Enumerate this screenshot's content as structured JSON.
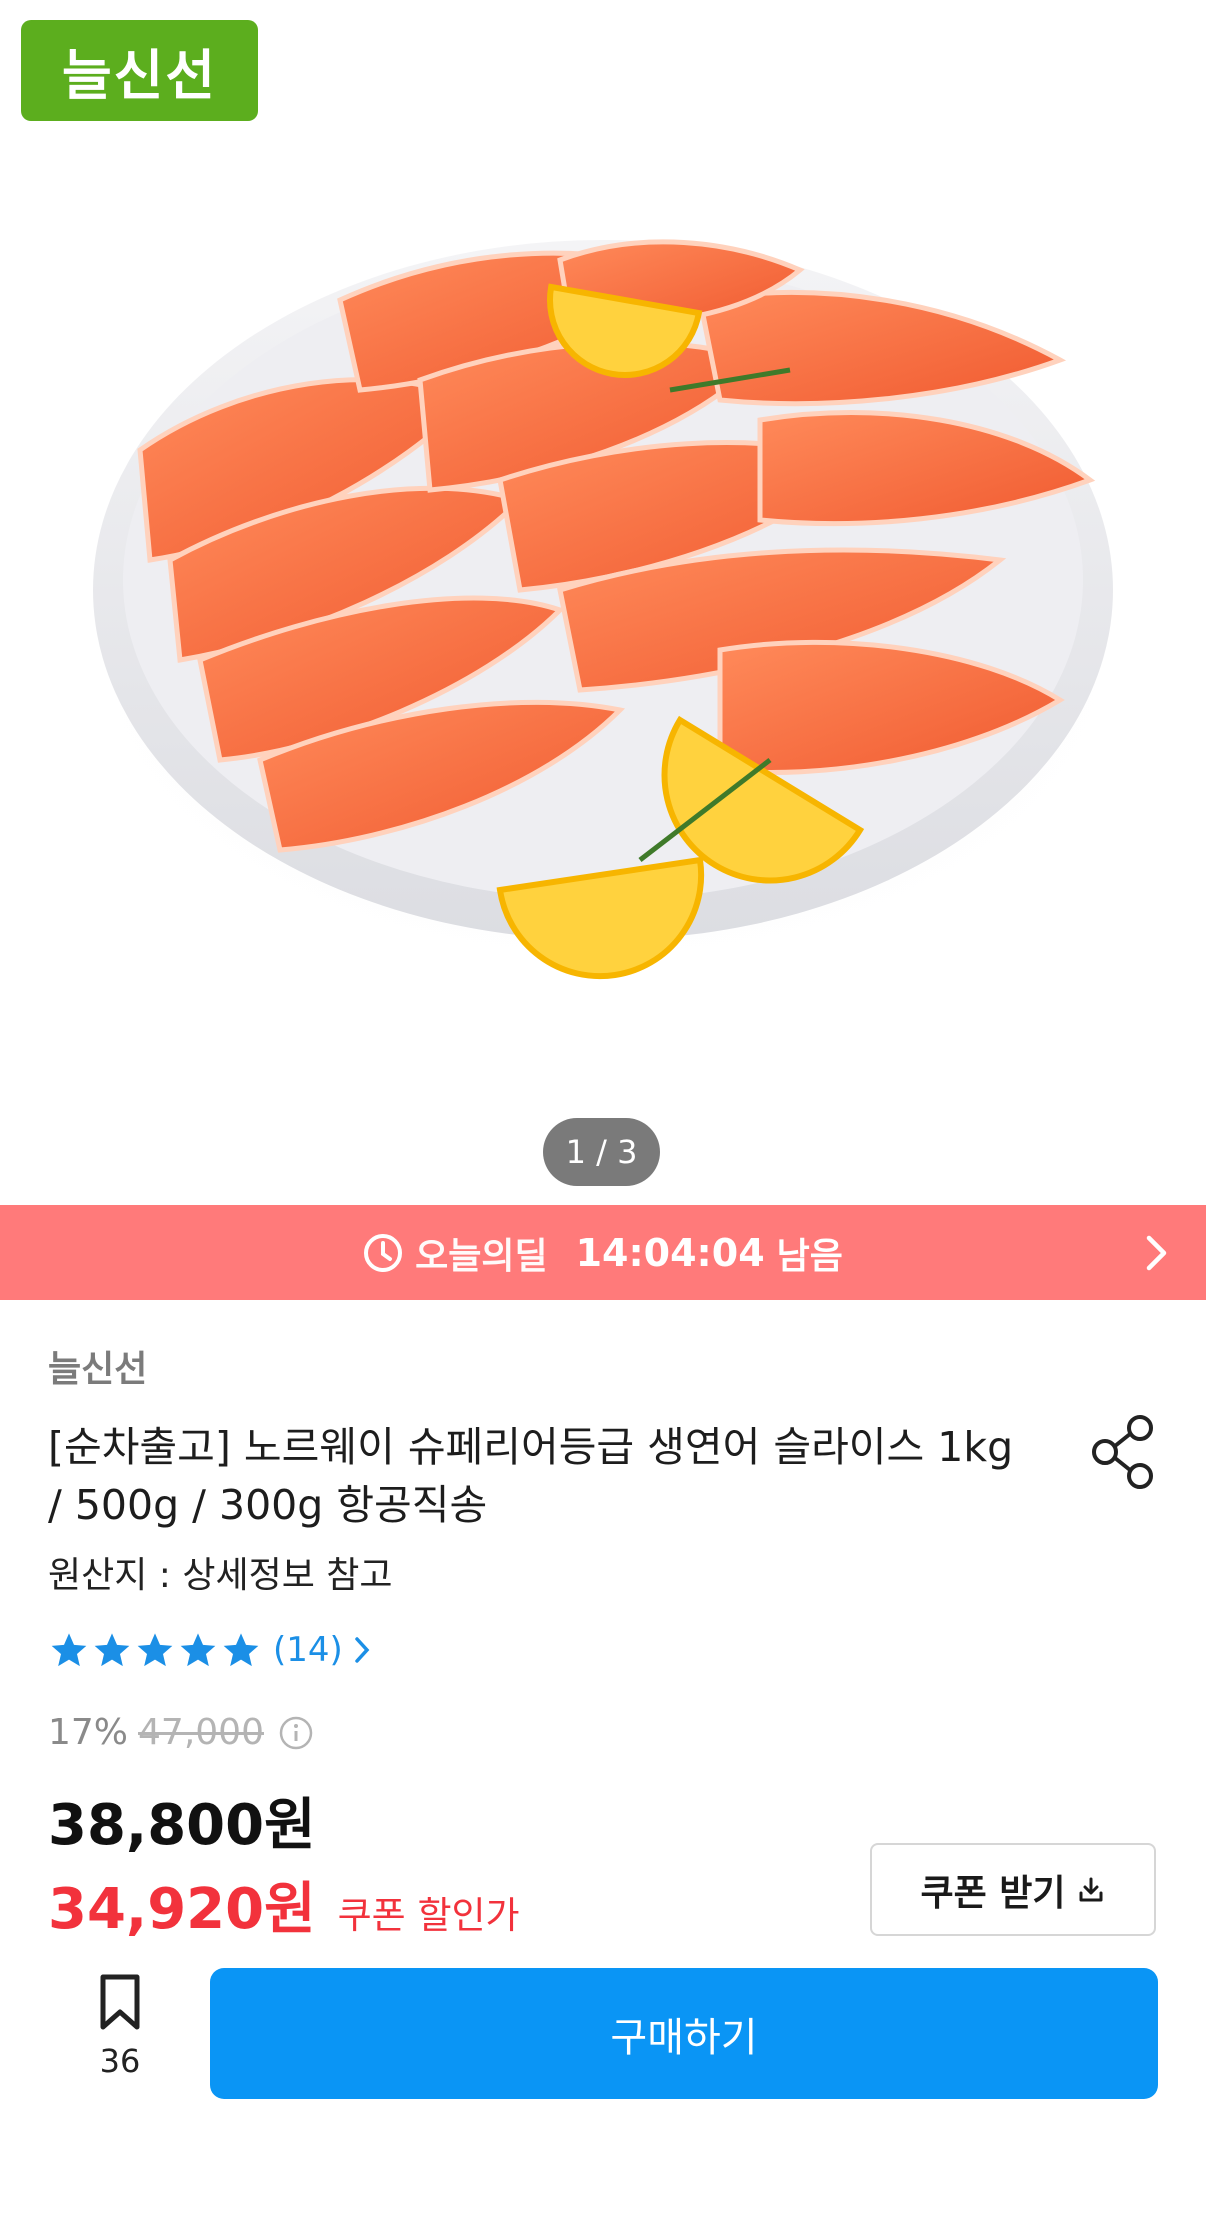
{
  "hero": {
    "badge": "늘신선",
    "counter": "1 / 3"
  },
  "deal": {
    "label": "오늘의딜",
    "time": "14:04:04",
    "suffix": "남음"
  },
  "product": {
    "seller": "늘신선",
    "title": "[순차출고] 노르웨이 슈페리어등급 생연어 슬라이스 1kg / 500g / 300g 항공직송",
    "origin": "원산지 : 상세정보 참고",
    "rating": {
      "stars": 5,
      "count": "(14)"
    },
    "discount_rate": "17%",
    "original_price": "47,000",
    "sale_price": "38,800원",
    "coupon_price": "34,920원",
    "coupon_label": "쿠폰 할인가",
    "coupon_button": "쿠폰 받기"
  },
  "bottom": {
    "wish_count": "36",
    "buy_label": "구매하기"
  },
  "colors": {
    "brand_green": "#5cae1e",
    "deal_banner": "#ff7a7a",
    "rating_blue": "#1b8fe6",
    "coupon_red": "#f2323c",
    "buy_blue": "#0a95f5"
  },
  "icons": [
    "clock-icon",
    "chevron-right-icon",
    "share-icon",
    "star-icon",
    "info-icon",
    "download-icon",
    "bookmark-icon"
  ]
}
